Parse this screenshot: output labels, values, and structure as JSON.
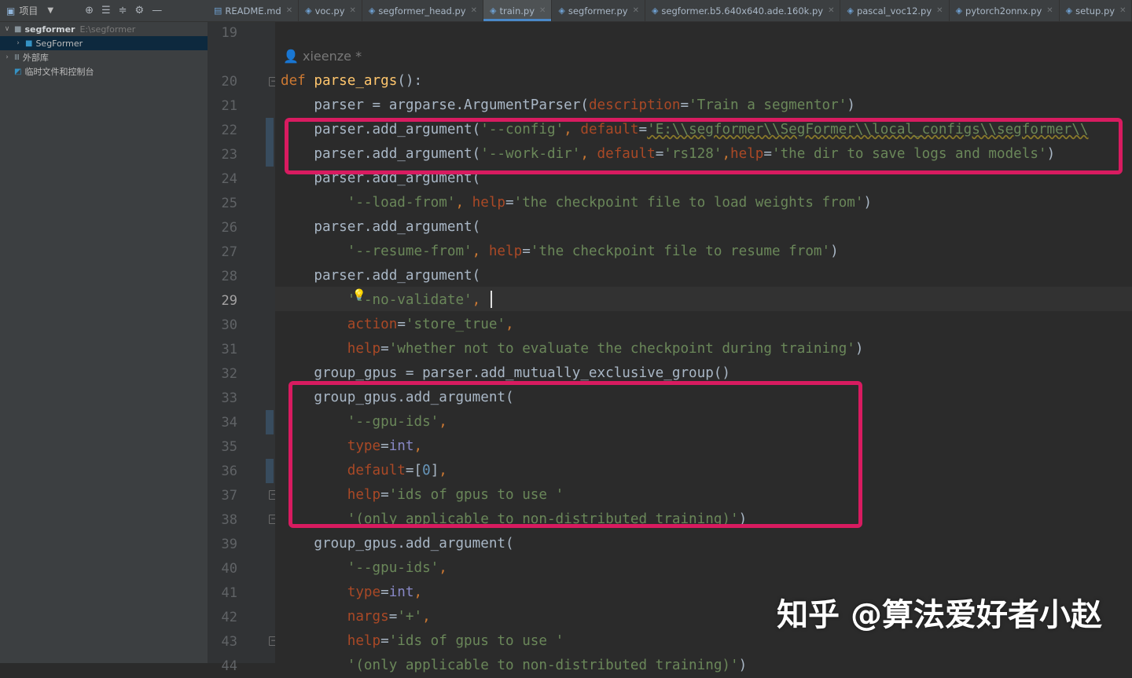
{
  "project_panel": {
    "title": "项目",
    "tree": [
      {
        "label": "segformer",
        "path": "E:\\segformer",
        "expanded": true
      },
      {
        "label": "SegFormer",
        "selected": true
      },
      {
        "label": "外部库"
      },
      {
        "label": "临时文件和控制台"
      }
    ]
  },
  "tabs": [
    {
      "label": "README.md"
    },
    {
      "label": "voc.py"
    },
    {
      "label": "segformer_head.py"
    },
    {
      "label": "train.py",
      "active": true
    },
    {
      "label": "segformer.py"
    },
    {
      "label": "segformer.b5.640x640.ade.160k.py"
    },
    {
      "label": "pascal_voc12.py"
    },
    {
      "label": "pytorch2onnx.py"
    },
    {
      "label": "setup.py"
    }
  ],
  "editor": {
    "author": "xieenze *",
    "current_line": 29,
    "line_numbers": [
      "19",
      "20",
      "21",
      "22",
      "23",
      "24",
      "25",
      "26",
      "27",
      "28",
      "29",
      "30",
      "31",
      "32",
      "33",
      "34",
      "35",
      "36",
      "37",
      "38",
      "39",
      "40",
      "41",
      "42",
      "43",
      "44"
    ],
    "lines": {
      "l20": "parse_args",
      "l21a": "parser = argparse.ArgumentParser(",
      "l21b": "description",
      "l21c": "'Train a segmentor'",
      "l22a": "parser.add_argument(",
      "l22b": "'--config'",
      "l22c": "default",
      "l22d": "'E:\\\\segformer\\\\SegFormer\\\\local_configs\\\\segformer\\\\",
      "l23a": "parser.add_argument(",
      "l23b": "'--work-dir'",
      "l23c": "default",
      "l23d": "'rs128'",
      "l23e": "help",
      "l23f": "'the dir to save logs and models'",
      "l24": "parser.add_argument(",
      "l25a": "'--load-from'",
      "l25b": "help",
      "l25c": "'the checkpoint file to load weights from'",
      "l26": "parser.add_argument(",
      "l27a": "'--resume-from'",
      "l27b": "help",
      "l27c": "'the checkpoint file to resume from'",
      "l28": "parser.add_argument(",
      "l29": "'--no-validate'",
      "l30a": "action",
      "l30b": "'store_true'",
      "l31a": "help",
      "l31b": "'whether not to evaluate the checkpoint during training'",
      "l32": "group_gpus = parser.add_mutually_exclusive_group()",
      "l33": "group_gpus.add_argument(",
      "l34": "'--gpu-ids'",
      "l35a": "type",
      "l35b": "int",
      "l36a": "default",
      "l36b": "0",
      "l37a": "help",
      "l37b": "'ids of gpus to use '",
      "l38": "'(only applicable to non-distributed training)'",
      "l39": "group_gpus.add_argument(",
      "l40": "'--gpu-ids'",
      "l41a": "type",
      "l41b": "int",
      "l42a": "nargs",
      "l42b": "'+'",
      "l43a": "help",
      "l43b": "'ids of gpus to use '",
      "l44": "'(only applicable to non-distributed training)'"
    }
  },
  "watermark": "知乎 @算法爱好者小赵",
  "colors": {
    "keyword": "#cc7832",
    "function": "#ffc66d",
    "string": "#6a8759",
    "param": "#aa4926",
    "number": "#6897bb",
    "highlight_box": "#d81b60"
  }
}
